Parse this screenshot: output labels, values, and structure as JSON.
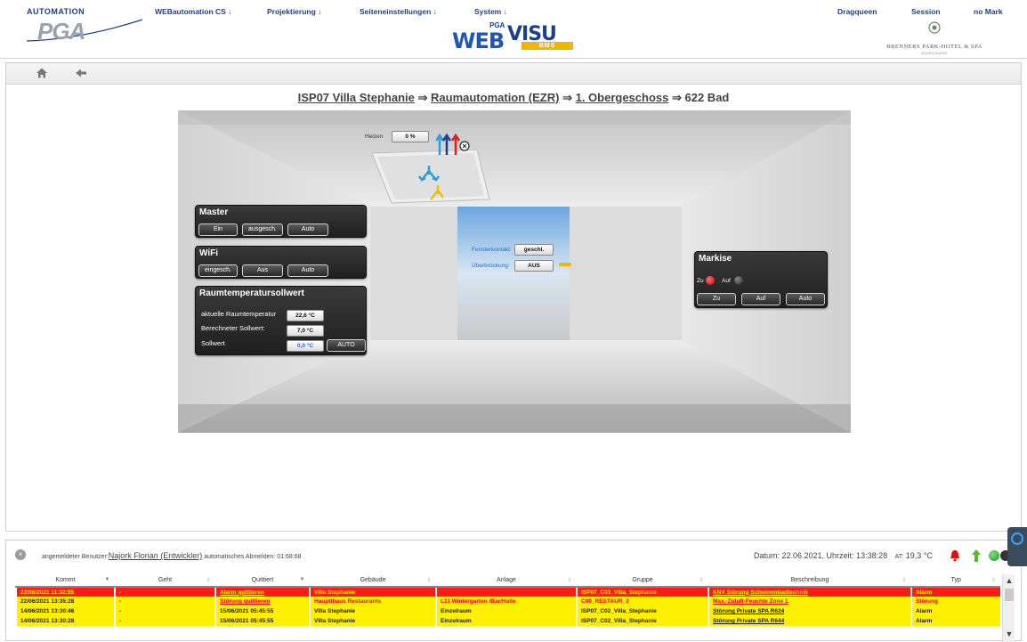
{
  "header": {
    "logo_small": "AUTOMATION",
    "logo_big": "PGA",
    "nav": [
      {
        "label": "WEBautomation CS ↓"
      },
      {
        "label": "Projektierung ↓"
      },
      {
        "label": "Seiteneinstellungen ↓"
      },
      {
        "label": "System ↓"
      }
    ],
    "right_links": [
      {
        "label": "Dragqueen"
      },
      {
        "label": "Session"
      },
      {
        "label": "no Mark"
      }
    ],
    "brand_small": "PGA",
    "brand_web": "WEB",
    "brand_visu": "VISU",
    "brand_bms": "BMS",
    "hotel_name": "BRENNERS PARK-HOTEL & SPA",
    "hotel_sub": "BADEN-BADEN"
  },
  "breadcrumb": {
    "part1": "ISP07 Villa Stephanie",
    "part2": "Raumautomation (EZR)",
    "part3": "1. Obergeschoss",
    "current": "622 Bad",
    "sep": " ⇒ "
  },
  "room": {
    "heizen_label": "Heizen",
    "heizen_value": "0 %",
    "fensterkontakt_label": "Fensterkontakt:",
    "fensterkontakt_value": "geschl.",
    "ueberbrueckung_label": "Überbrückung:",
    "ueberbrueckung_value": "AUS"
  },
  "master": {
    "title": "Master",
    "buttons": [
      "Ein",
      "ausgesch.",
      "Auto"
    ]
  },
  "wifi": {
    "title": "WiFi",
    "buttons": [
      "eingesch.",
      "Aus",
      "Auto"
    ]
  },
  "raumtemp": {
    "title": "Raumtemperatursollwert",
    "aktuelle_label": "aktuelle Raumtemperatur",
    "aktuelle_value": "22,6 °C",
    "berechnet_label": "Berechneter Sollwert:",
    "berechnet_value": "7,0 °C",
    "sollwert_label": "Sollwert",
    "sollwert_value": "0,0 °C",
    "auto_button": "AUTO"
  },
  "markise": {
    "title": "Markise",
    "zu_label": "Zu",
    "auf_label": "Auf",
    "buttons": [
      "Zu",
      "Auf",
      "Auto"
    ]
  },
  "status": {
    "user_prefix": "angemeldeter Benutzer:",
    "user_name": "Najork Florian (Entwickler)",
    "auto_logout": "automatisches Abmelden: 01:68:68",
    "datetime": "Datum: 22.06.2021, Uhrzeit: 13:38:28",
    "at_label": "AT:",
    "at_value": "19,3 °C"
  },
  "table": {
    "headers": [
      "Kommt",
      "Geht",
      "Quittiert",
      "Gebäude",
      "Anlage",
      "Gruppe",
      "Beschreibung",
      "Typ"
    ],
    "rows": [
      {
        "kommt": "22/06/2021 11:32:55",
        "geht": "-",
        "quittiert": "Alarm quittieren",
        "gebaeude": "Villa Stephanie",
        "anlage": "",
        "gruppe": "ISP07_C03_Villa_Stephanie",
        "beschreibung": "KNX Störung Schwimmbadtechnik",
        "typ": "Alarm"
      },
      {
        "kommt": "22/06/2021 13:35:28",
        "geht": "-",
        "quittiert": "Störung quittieren",
        "gebaeude": "Hauptthaus Restaurants",
        "anlage": "L11 Wintergarten /Bar/Halle",
        "gruppe": "C09_RESTAUR_3",
        "beschreibung": "Max.-Zuluft-Feuchte Zone 1",
        "typ": "Störung"
      },
      {
        "kommt": "14/06/2021 13:30:46",
        "geht": "-",
        "quittiert": "15/06/2021 05:45:55",
        "gebaeude": "Villa Stephanie",
        "anlage": "Einzelraum",
        "gruppe": "ISP07_C02_Villa_Stephanie",
        "beschreibung": "Störung Private SPA R624",
        "typ": "Alarm"
      },
      {
        "kommt": "14/06/2021 13:30:28",
        "geht": "-",
        "quittiert": "15/06/2021 05:45:55",
        "gebaeude": "Villa Stephanie",
        "anlage": "Einzelraum",
        "gruppe": "ISP07_C02_Villa_Stephanie",
        "beschreibung": "Störung Private SPA R644",
        "typ": "Alarm"
      }
    ]
  },
  "colors": {
    "nav_blue": "#1e3f8c",
    "alarm_red": "#ff1a1a",
    "alarm_yellow": "#fff000",
    "panel_dark": "#2a2a2a"
  }
}
